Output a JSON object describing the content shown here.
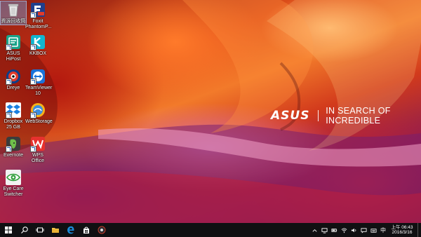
{
  "wallpaper": {
    "brand_logo": "ASUS",
    "tagline": "IN SEARCH OF INCREDIBLE"
  },
  "desktop_icons": [
    {
      "label": "資源回收筒",
      "icon": "recycle-bin-icon"
    },
    {
      "label": "Foxit PhantomP...",
      "icon": "foxit-pdf-icon"
    },
    {
      "label": "ASUS HiPost",
      "icon": "asus-hipost-icon"
    },
    {
      "label": "KKBOX",
      "icon": "kkbox-icon"
    },
    {
      "label": "Dreye",
      "icon": "dreye-icon"
    },
    {
      "label": "TeamViewer 10",
      "icon": "teamviewer-icon"
    },
    {
      "label": "Dropbox 25 GB",
      "icon": "dropbox-icon"
    },
    {
      "label": "WebStorage",
      "icon": "webstorage-icon"
    },
    {
      "label": "Evernote",
      "icon": "evernote-icon"
    },
    {
      "label": "WPS Office",
      "icon": "wps-office-icon"
    },
    {
      "label": "Eye Care Switcher",
      "icon": "eye-care-icon"
    }
  ],
  "taskbar": {
    "items": [
      "start-icon",
      "search-icon",
      "task-view-icon",
      "file-explorer-icon",
      "edge-icon",
      "store-icon",
      "app-icon"
    ],
    "tray": {
      "ime": "中",
      "time_period": "上午",
      "time": "06:43",
      "date": "2016/3/16"
    }
  },
  "colors": {
    "taskbar": "#101012",
    "accent_blue": "#1a73d9"
  }
}
